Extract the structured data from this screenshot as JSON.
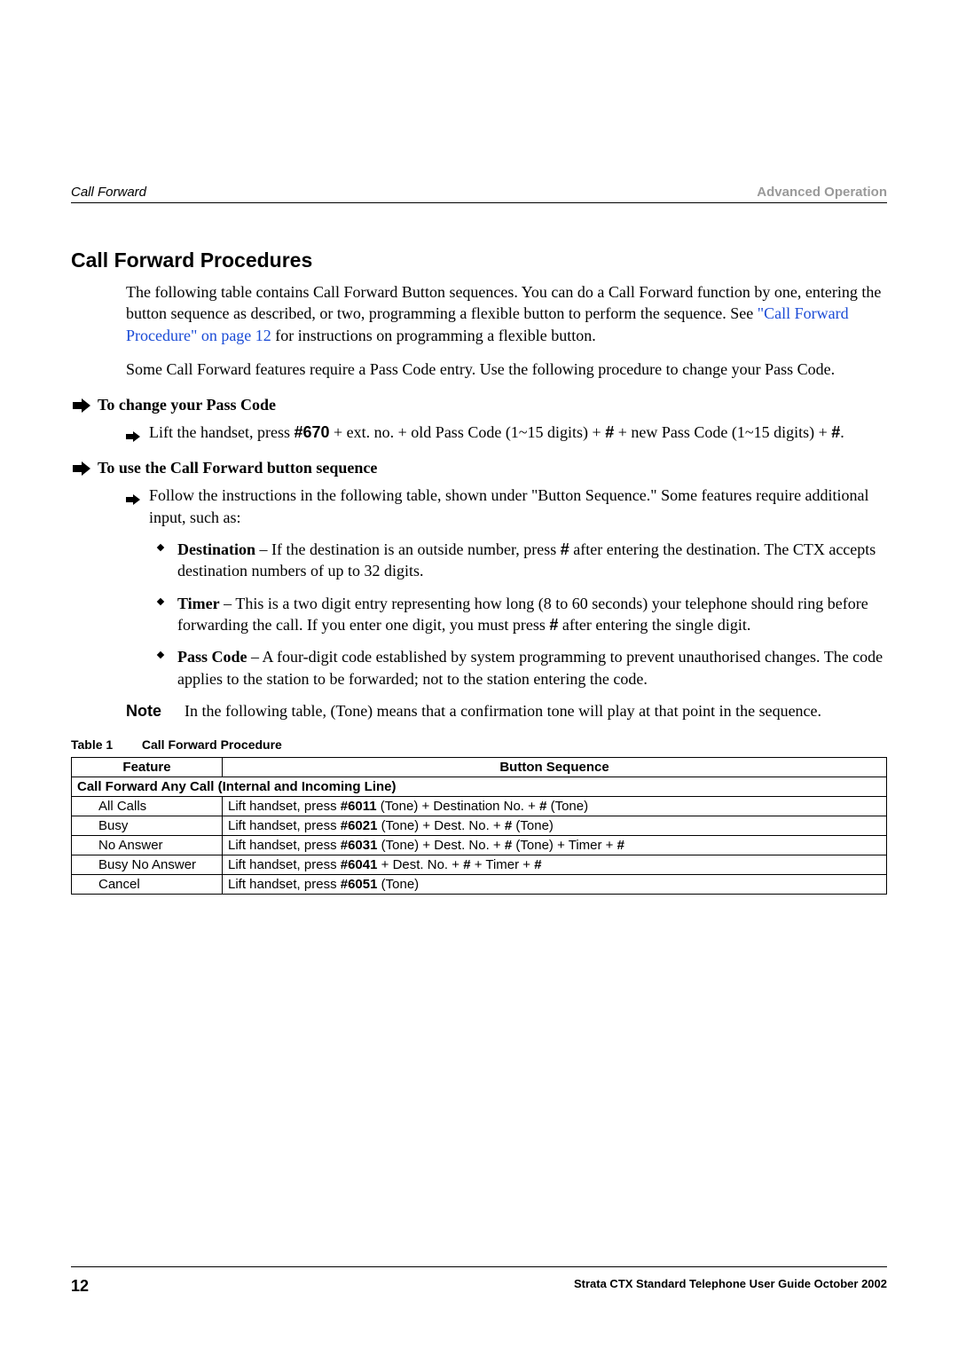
{
  "header": {
    "left": "Call Forward",
    "right": "Advanced Operation"
  },
  "section": {
    "title": "Call Forward Procedures",
    "para1_a": "The following table contains Call Forward Button sequences. You can do a Call Forward function by one, entering the button sequence as described, or two, programming a flexible button to perform the sequence. See ",
    "para1_link": "\"Call Forward Procedure\" on page 12",
    "para1_b": " for instructions on programming a flexible button.",
    "para2": "Some Call Forward features require a Pass Code entry. Use the following procedure to change your Pass Code."
  },
  "proc1": {
    "heading": "To change your Pass Code",
    "step_a": "Lift the handset, press ",
    "step_code1": "#670",
    "step_b": " + ext. no. + old Pass Code (1~15 digits) + ",
    "step_hash1": "#",
    "step_c": " + new Pass Code (1~15 digits) + ",
    "step_hash2": "#",
    "step_d": "."
  },
  "proc2": {
    "heading": "To use the Call Forward button sequence",
    "step1": "Follow the instructions in the following table, shown under \"Button Sequence.\" Some features require additional input, such as:",
    "b1_label": "Destination",
    "b1_a": " – If the destination is an outside number, press ",
    "b1_hash": "#",
    "b1_b": " after entering the destination. The CTX accepts destination numbers of up to 32 digits.",
    "b2_label": "Timer",
    "b2_a": " – This is a two digit entry representing how long (8 to 60 seconds) your telephone should ring before forwarding the call. If you enter one digit, you must press ",
    "b2_hash": "#",
    "b2_b": " after entering the single digit.",
    "b3_label": "Pass Code",
    "b3_text": " – A four-digit code established by system programming to prevent unauthorised changes. The code applies to the station to be forwarded; not to the station entering the code."
  },
  "note": {
    "label": "Note",
    "text": "In the following table, (Tone) means that a confirmation tone will play at that point in the sequence."
  },
  "table": {
    "caption_label": "Table 1",
    "caption_text": "Call Forward Procedure",
    "head_feature": "Feature",
    "head_seq": "Button Sequence",
    "subhead": "Call Forward Any Call (Internal and Incoming Line)",
    "rows": [
      {
        "feature": "All Calls",
        "seq_a": "Lift handset, press ",
        "seq_code": "#6011",
        "seq_b": " (Tone) + Destination No. + ",
        "seq_hash": "#",
        "seq_c": " (Tone)"
      },
      {
        "feature": "Busy",
        "seq_a": "Lift handset, press ",
        "seq_code": "#6021",
        "seq_b": " (Tone) + Dest. No. + ",
        "seq_hash": "#",
        "seq_c": " (Tone)"
      },
      {
        "feature": "No Answer",
        "seq_a": "Lift handset, press ",
        "seq_code": "#6031",
        "seq_b": " (Tone) + Dest. No. + ",
        "seq_hash": "#",
        "seq_c": " (Tone) + Timer + ",
        "seq_hash2": "#",
        "seq_d": ""
      },
      {
        "feature": "Busy No Answer",
        "seq_a": "Lift handset, press ",
        "seq_code": "#6041",
        "seq_b": " + Dest. No. + ",
        "seq_hash": "#",
        "seq_c": " + Timer + ",
        "seq_hash2": "#",
        "seq_d": ""
      },
      {
        "feature": "Cancel",
        "seq_a": "Lift handset, press ",
        "seq_code": "#6051",
        "seq_b": " (Tone)",
        "seq_hash": "",
        "seq_c": "",
        "seq_hash2": "",
        "seq_d": ""
      }
    ]
  },
  "footer": {
    "page": "12",
    "text": "Strata CTX Standard Telephone User Guide  October 2002"
  }
}
